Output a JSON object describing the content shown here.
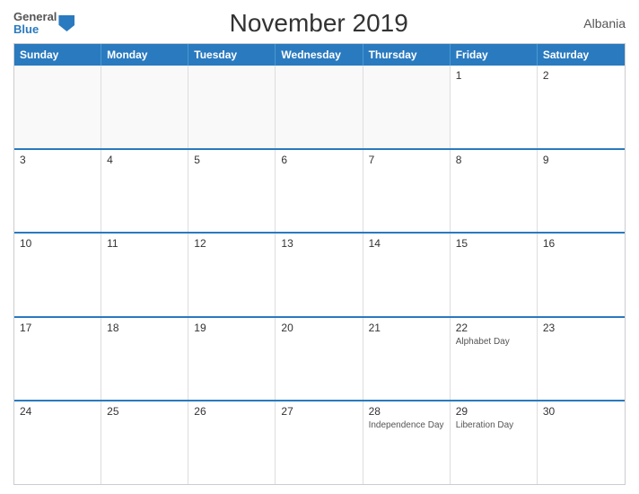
{
  "header": {
    "logo_general": "General",
    "logo_blue": "Blue",
    "title": "November 2019",
    "country": "Albania"
  },
  "calendar": {
    "days_of_week": [
      "Sunday",
      "Monday",
      "Tuesday",
      "Wednesday",
      "Thursday",
      "Friday",
      "Saturday"
    ],
    "rows": [
      [
        {
          "day": "",
          "event": ""
        },
        {
          "day": "",
          "event": ""
        },
        {
          "day": "",
          "event": ""
        },
        {
          "day": "",
          "event": ""
        },
        {
          "day": "",
          "event": ""
        },
        {
          "day": "1",
          "event": ""
        },
        {
          "day": "2",
          "event": ""
        }
      ],
      [
        {
          "day": "3",
          "event": ""
        },
        {
          "day": "4",
          "event": ""
        },
        {
          "day": "5",
          "event": ""
        },
        {
          "day": "6",
          "event": ""
        },
        {
          "day": "7",
          "event": ""
        },
        {
          "day": "8",
          "event": ""
        },
        {
          "day": "9",
          "event": ""
        }
      ],
      [
        {
          "day": "10",
          "event": ""
        },
        {
          "day": "11",
          "event": ""
        },
        {
          "day": "12",
          "event": ""
        },
        {
          "day": "13",
          "event": ""
        },
        {
          "day": "14",
          "event": ""
        },
        {
          "day": "15",
          "event": ""
        },
        {
          "day": "16",
          "event": ""
        }
      ],
      [
        {
          "day": "17",
          "event": ""
        },
        {
          "day": "18",
          "event": ""
        },
        {
          "day": "19",
          "event": ""
        },
        {
          "day": "20",
          "event": ""
        },
        {
          "day": "21",
          "event": ""
        },
        {
          "day": "22",
          "event": "Alphabet Day"
        },
        {
          "day": "23",
          "event": ""
        }
      ],
      [
        {
          "day": "24",
          "event": ""
        },
        {
          "day": "25",
          "event": ""
        },
        {
          "day": "26",
          "event": ""
        },
        {
          "day": "27",
          "event": ""
        },
        {
          "day": "28",
          "event": "Independence Day"
        },
        {
          "day": "29",
          "event": "Liberation Day"
        },
        {
          "day": "30",
          "event": ""
        }
      ]
    ]
  }
}
